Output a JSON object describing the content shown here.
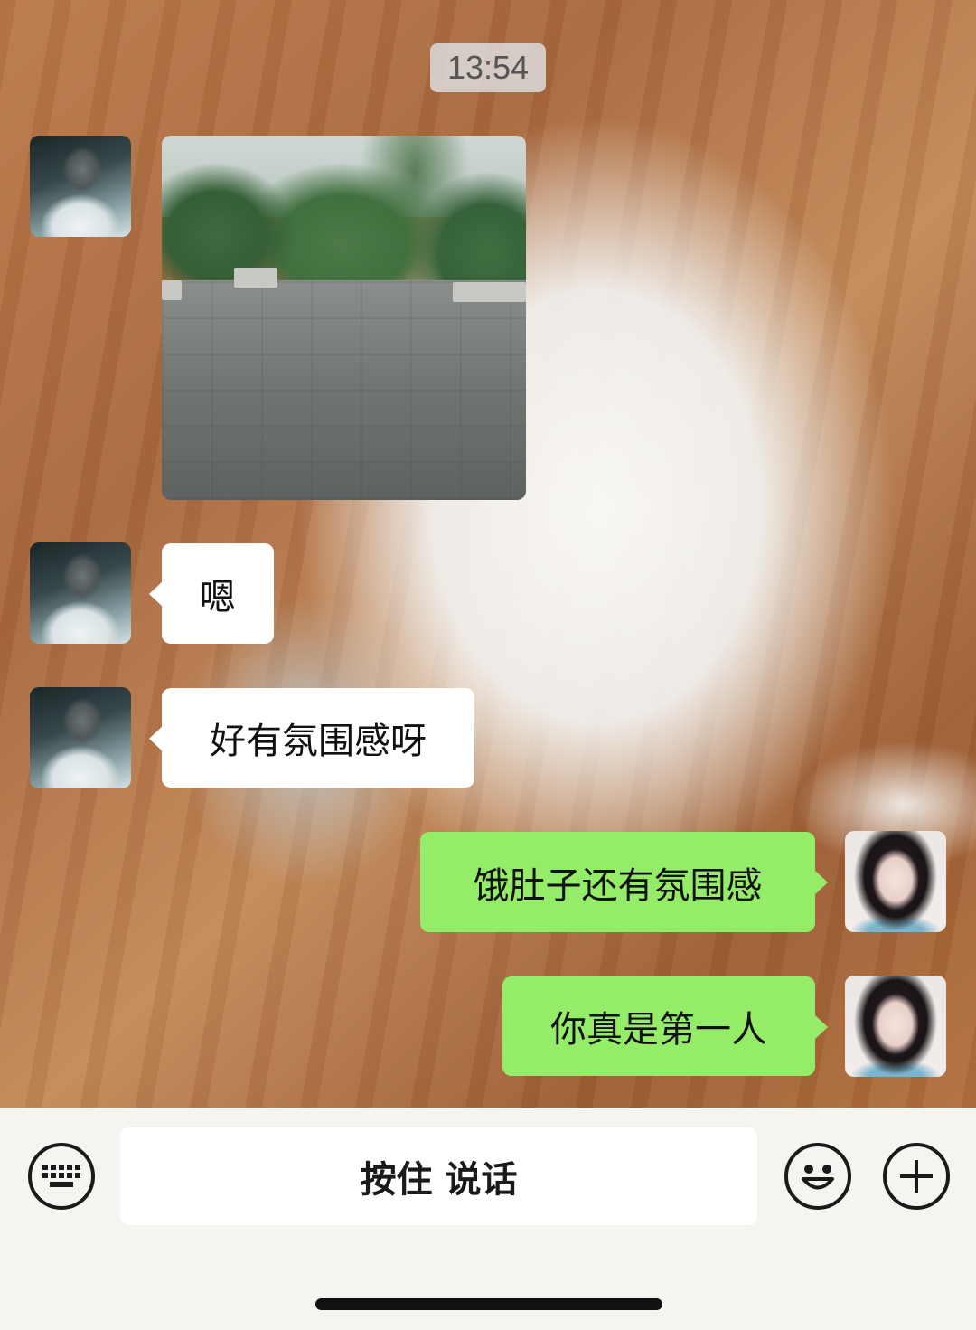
{
  "chat": {
    "timestamp": "13:54",
    "messages": [
      {
        "side": "left",
        "type": "image",
        "avatar": "contact-avatar",
        "image": "rainy-park-path-photo"
      },
      {
        "side": "left",
        "type": "text",
        "text": "嗯"
      },
      {
        "side": "left",
        "type": "text",
        "text": "好有氛围感呀"
      },
      {
        "side": "right",
        "type": "text",
        "text": "饿肚子还有氛围感"
      },
      {
        "side": "right",
        "type": "text",
        "text": "你真是第一人"
      }
    ]
  },
  "input_bar": {
    "keyboard_icon": "keyboard-icon",
    "hold_to_talk_label": "按住 说话",
    "emoji_icon": "emoji-icon",
    "plus_icon": "plus-icon"
  },
  "colors": {
    "sent_bubble": "#95ec69",
    "received_bubble": "#ffffff",
    "input_bar_bg": "#f5f4f1"
  }
}
